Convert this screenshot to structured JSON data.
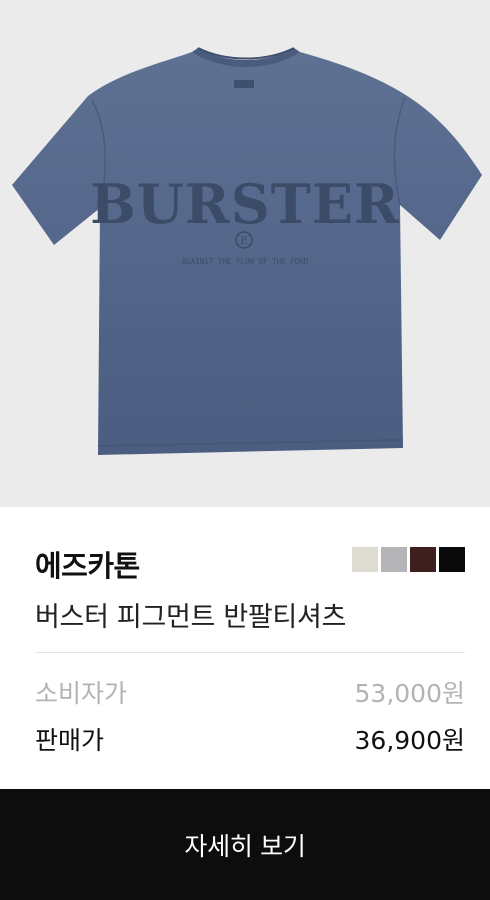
{
  "product": {
    "image_alt": "t-shirt-image",
    "print": {
      "logo": "BURSTER",
      "monogram": "E",
      "tagline": "AGAINST THE FLOW OF THE FORD"
    },
    "brand": "에즈카톤",
    "name": "버스터 피그먼트 반팔티셔츠",
    "swatches": [
      "#dedcd2",
      "#b5b5b7",
      "#3f1f1d",
      "#0a0a0a"
    ]
  },
  "pricing": {
    "msrp_label": "소비자가",
    "msrp_value": "53,000원",
    "sale_label": "판매가",
    "sale_value": "36,900원"
  },
  "cta": {
    "label": "자세히 보기"
  },
  "colors": {
    "shirt": "#56698a",
    "background": "#ebebeb",
    "cta_bg": "#0d0d0d"
  }
}
